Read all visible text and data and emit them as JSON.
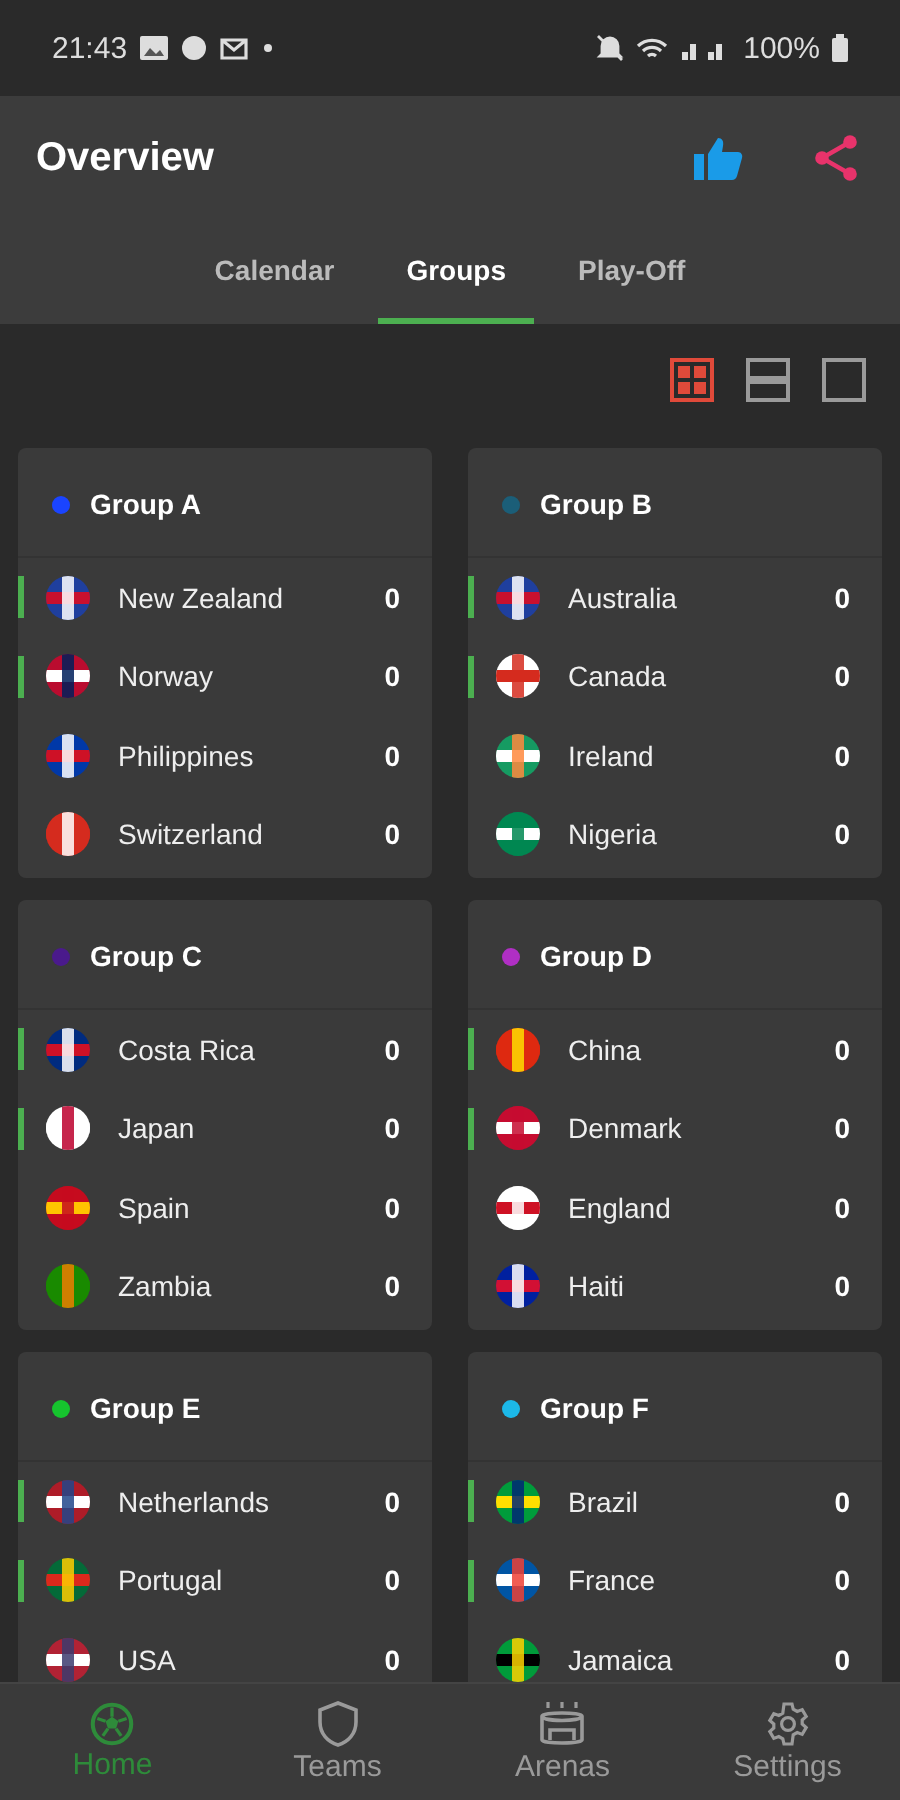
{
  "status_bar": {
    "time": "21:43",
    "battery": "100%"
  },
  "app_bar": {
    "title": "Overview"
  },
  "tabs": [
    {
      "label": "Calendar",
      "selected": false
    },
    {
      "label": "Groups",
      "selected": true
    },
    {
      "label": "Play-Off",
      "selected": false
    }
  ],
  "view_toggles": [
    {
      "kind": "grid",
      "selected": true
    },
    {
      "kind": "rows",
      "selected": false
    },
    {
      "kind": "single",
      "selected": false
    }
  ],
  "groups": [
    {
      "name": "Group A",
      "color": "#1a44ff",
      "teams": [
        {
          "name": "New Zealand",
          "points": "0",
          "marked": true
        },
        {
          "name": "Norway",
          "points": "0",
          "marked": true
        },
        {
          "name": "Philippines",
          "points": "0",
          "marked": false
        },
        {
          "name": "Switzerland",
          "points": "0",
          "marked": false
        }
      ]
    },
    {
      "name": "Group B",
      "color": "#1b5e78",
      "teams": [
        {
          "name": "Australia",
          "points": "0",
          "marked": true
        },
        {
          "name": "Canada",
          "points": "0",
          "marked": true
        },
        {
          "name": "Ireland",
          "points": "0",
          "marked": false
        },
        {
          "name": "Nigeria",
          "points": "0",
          "marked": false
        }
      ]
    },
    {
      "name": "Group C",
      "color": "#4a1a8c",
      "teams": [
        {
          "name": "Costa Rica",
          "points": "0",
          "marked": true
        },
        {
          "name": "Japan",
          "points": "0",
          "marked": true
        },
        {
          "name": "Spain",
          "points": "0",
          "marked": false
        },
        {
          "name": "Zambia",
          "points": "0",
          "marked": false
        }
      ]
    },
    {
      "name": "Group D",
      "color": "#b02fc4",
      "teams": [
        {
          "name": "China",
          "points": "0",
          "marked": true
        },
        {
          "name": "Denmark",
          "points": "0",
          "marked": true
        },
        {
          "name": "England",
          "points": "0",
          "marked": false
        },
        {
          "name": "Haiti",
          "points": "0",
          "marked": false
        }
      ]
    },
    {
      "name": "Group E",
      "color": "#16c42e",
      "teams": [
        {
          "name": "Netherlands",
          "points": "0",
          "marked": true
        },
        {
          "name": "Portugal",
          "points": "0",
          "marked": true
        },
        {
          "name": "USA",
          "points": "0",
          "marked": false
        }
      ]
    },
    {
      "name": "Group F",
      "color": "#1cb8e8",
      "teams": [
        {
          "name": "Brazil",
          "points": "0",
          "marked": true
        },
        {
          "name": "France",
          "points": "0",
          "marked": true
        },
        {
          "name": "Jamaica",
          "points": "0",
          "marked": false
        }
      ]
    }
  ],
  "bottom_nav": [
    {
      "kind": "home",
      "label": "Home",
      "selected": true
    },
    {
      "kind": "teams",
      "label": "Teams",
      "selected": false
    },
    {
      "kind": "arenas",
      "label": "Arenas",
      "selected": false
    },
    {
      "kind": "settings",
      "label": "Settings",
      "selected": false
    }
  ]
}
